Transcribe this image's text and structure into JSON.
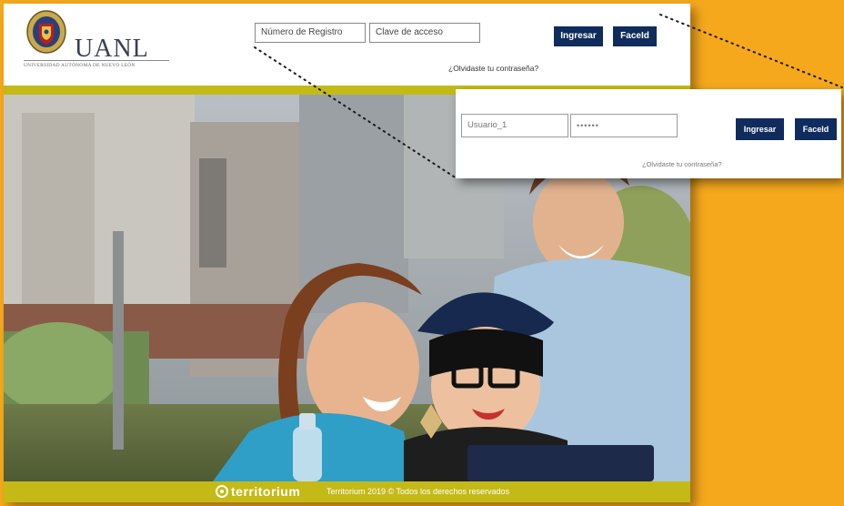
{
  "header": {
    "logo_text": "UANL",
    "logo_subtext": "UNIVERSIDAD AUTÓNOMA DE NUEVO LEÓN",
    "username_placeholder": "Número de Registro",
    "password_placeholder": "Clave de acceso",
    "login_label": "Ingresar",
    "faceid_label": "FaceId",
    "forgot_label": "¿Olvidaste tu contraseña?"
  },
  "callout": {
    "username_value": "Usuario_1",
    "password_value": "••••••",
    "login_label": "Ingresar",
    "faceid_label": "FaceId",
    "forgot_label": "¿Olvidaste tu contraseña?"
  },
  "footer": {
    "brand": "territorium",
    "copyright": "Territorium 2019 © Todos los derechos reservados"
  },
  "colors": {
    "background": "#f5a81c",
    "button": "#0f2c5c",
    "accent_bar": "#c4ba17"
  },
  "icons": {
    "brand": "target-circle-icon",
    "seal": "university-seal-icon"
  }
}
